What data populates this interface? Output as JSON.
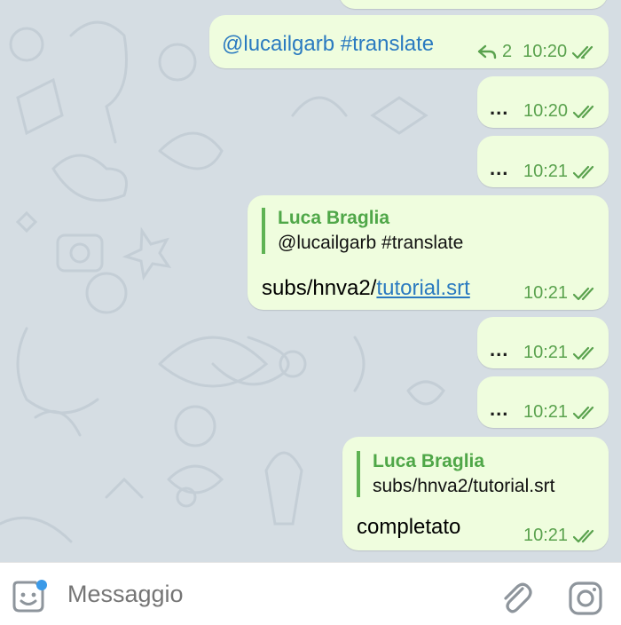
{
  "messages": [
    {
      "text": "@lucailgarb #translate",
      "replies_count": "2",
      "time": "10:20"
    },
    {
      "text": "...",
      "time": "10:20"
    },
    {
      "text": "...",
      "time": "10:21"
    },
    {
      "reply_name": "Luca Braglia",
      "reply_text": "@lucailgarb #translate",
      "text_prefix": "subs/hnva2/",
      "link": "tutorial.srt",
      "time": "10:21"
    },
    {
      "text": "...",
      "time": "10:21"
    },
    {
      "text": "...",
      "time": "10:21"
    },
    {
      "reply_name": "Luca Braglia",
      "reply_text": "subs/hnva2/tutorial.srt",
      "text": "completato",
      "time": "10:21"
    }
  ],
  "input": {
    "placeholder": "Messaggio"
  },
  "icons": {
    "reply": "reply-arrow-icon",
    "read": "double-check-icon",
    "emoji": "sticker-emoji-icon",
    "attach": "paperclip-icon",
    "camera": "camera-icon"
  },
  "colors": {
    "bubble": "#effdde",
    "meta": "#5aa24e",
    "reply_name": "#4fa748",
    "link": "#2a7ac0",
    "notification_dot": "#3b9ae8"
  }
}
